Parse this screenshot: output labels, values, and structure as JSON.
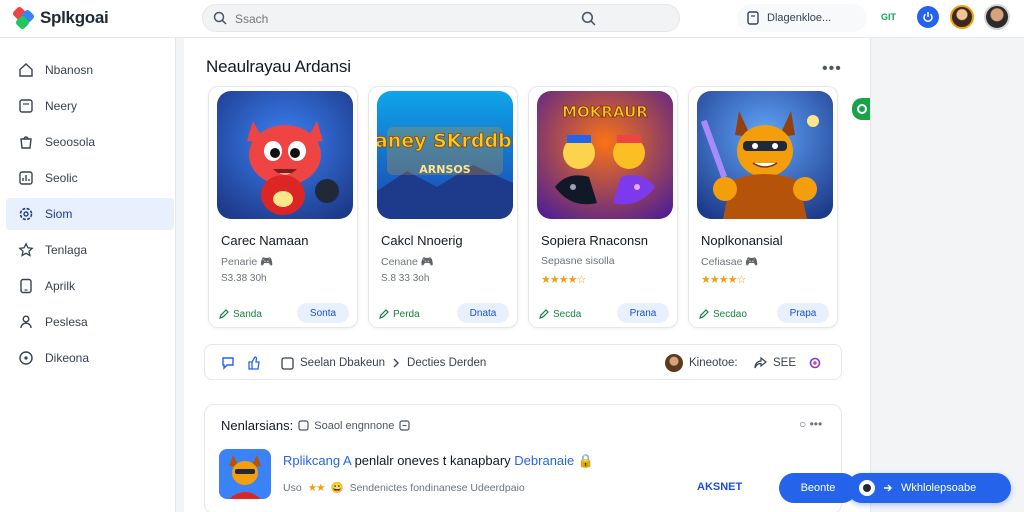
{
  "app": {
    "name": "Splkgoai"
  },
  "search": {
    "placeholder": "Ssach"
  },
  "header": {
    "account_label": "Dlagenkloe...",
    "badge_text": "GIT"
  },
  "sidebar": {
    "items": [
      {
        "label": "Nbanosn",
        "icon": "home-icon"
      },
      {
        "label": "Neery",
        "icon": "news-icon"
      },
      {
        "label": "Seoosola",
        "icon": "bag-icon"
      },
      {
        "label": "Seolic",
        "icon": "chart-icon"
      },
      {
        "label": "Siom",
        "icon": "gear-icon",
        "active": true
      },
      {
        "label": "Tenlaga",
        "icon": "star-icon"
      },
      {
        "label": "Aprilk",
        "icon": "tablet-icon"
      },
      {
        "label": "Peslesa",
        "icon": "person-icon"
      },
      {
        "label": "Dikeona",
        "icon": "clock-icon"
      }
    ]
  },
  "section": {
    "title": "Neaulrayau Ardansi"
  },
  "cards": [
    {
      "title": "Carec Namaan",
      "subtitle": "Penarie 🎮",
      "meta": "S3.38 30h",
      "left_btn": "Sanda",
      "right_btn": "Sonta"
    },
    {
      "title": "Cakcl Nnoerig",
      "subtitle": "Cenane 🎮",
      "meta": "S.8 33 3oh",
      "left_btn": "Perda",
      "right_btn": "Dnata",
      "art_text": "Haney SKrddbia",
      "art_sub": "ARNSOS"
    },
    {
      "title": "Sopiera Rnaconsn",
      "subtitle": "Sepasne sisolla",
      "rating": 4,
      "left_btn": "Secda",
      "right_btn": "Prana",
      "art_text": "MOKRAUR"
    },
    {
      "title": "Noplkonansial",
      "subtitle": "Cefiasae 🎮",
      "rating": 4,
      "left_btn": "Secdao",
      "right_btn": "Prapa"
    }
  ],
  "action_bar": {
    "crumb_a": "Seelan Dbakeun",
    "crumb_b": "Decties Derden",
    "user_name": "Kineotoe:",
    "share_label": "SEE"
  },
  "panel": {
    "title": "Nenlarsians:",
    "subtitle": "Soaol engnnone",
    "result_link": "Rplikcang A",
    "result_rest": "penlalr oneves t kanapbary",
    "result_link2": "Debranaie",
    "result_meta_a": "Uso",
    "result_meta_b": "Sendenictes fondinanese Udeerdpaio",
    "assist_label": "AKSNET",
    "button_label": "Beonte"
  },
  "float_button": {
    "label": "Wkhlolepsoabe"
  },
  "colors": {
    "accent": "#2563eb",
    "success": "#16a34a",
    "star": "#f59e0b"
  }
}
